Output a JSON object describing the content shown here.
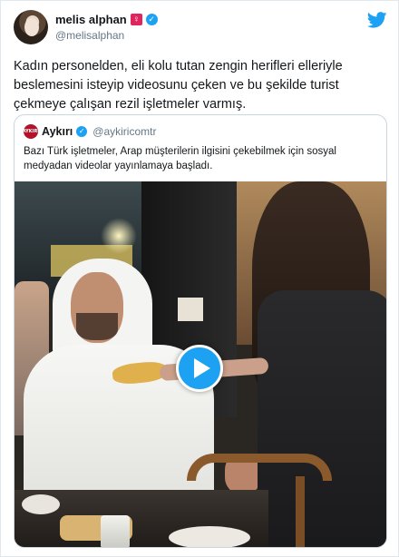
{
  "tweet": {
    "display_name": "melis alphan",
    "gender_emoji": "♀",
    "handle": "@melisalphan",
    "text": "Kadın personelden, eli kolu tutan zengin herifleri elleriyle beslemesini isteyip videosunu çeken ve bu şekilde turist çekmeye çalışan rezil işletmeler varmış."
  },
  "quote": {
    "avatar_text": "AYKIRI",
    "display_name": "Aykırı",
    "handle": "@aykiricomtr",
    "text": "Bazı Türk işletmeler, Arap müşterilerin ilgisini çekebilmek için sosyal medyadan videolar yayınlamaya başladı."
  },
  "colors": {
    "twitter_blue": "#1da1f2",
    "text_primary": "#14171a",
    "text_secondary": "#657786",
    "border": "#ccd6dd"
  },
  "icons": {
    "brand": "twitter-bird-icon",
    "verified": "verified-badge-icon",
    "play": "play-icon"
  }
}
